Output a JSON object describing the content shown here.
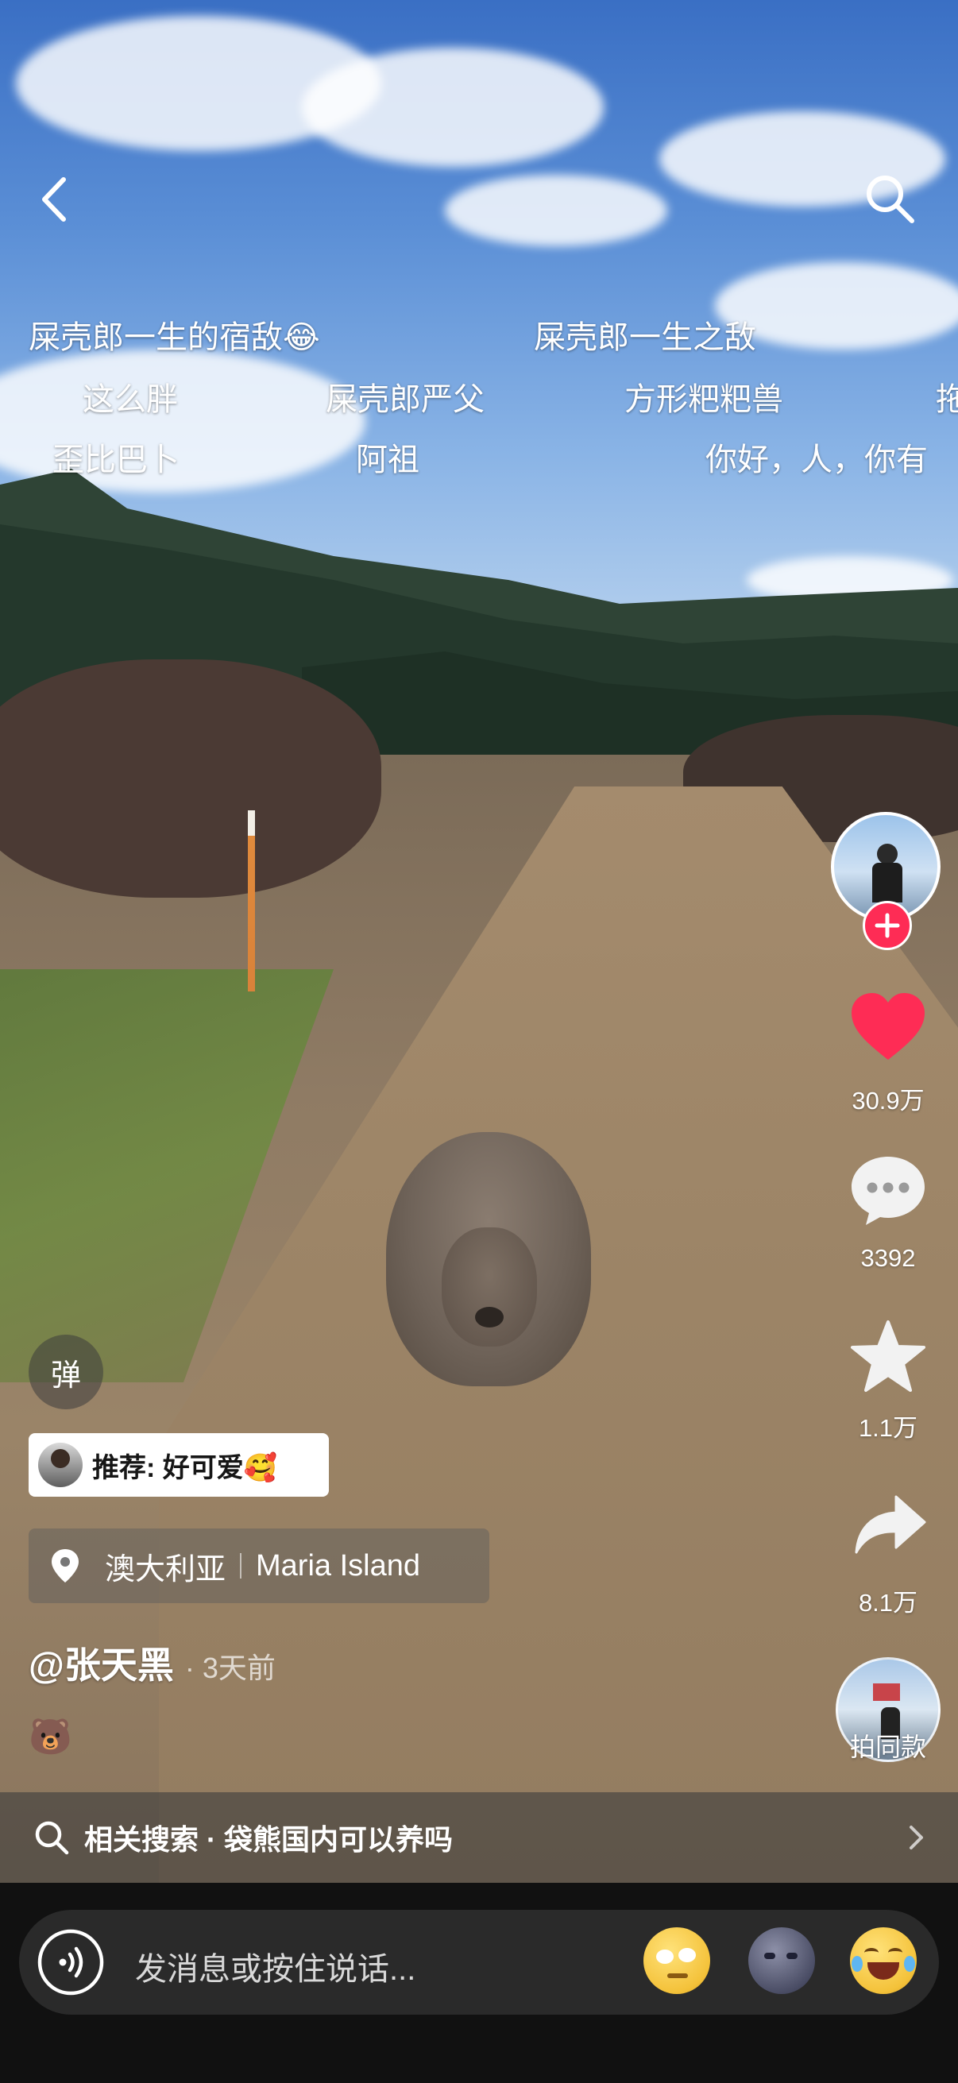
{
  "danmu": [
    "屎壳郎一生的宿敌😂",
    "屎壳郎一生之敌",
    "这么胖",
    "屎壳郎严父",
    "方形粑粑兽",
    "拖",
    "歪比巴卜",
    "阿祖",
    "你好，人，你有"
  ],
  "sidebar": {
    "like_count": "30.9万",
    "comment_count": "3392",
    "favorite_count": "1.1万",
    "share_count": "8.1万",
    "same_style_label": "拍同款"
  },
  "danmu_toggle_label": "弹",
  "recommend": {
    "label": "推荐: 好可爱🥰"
  },
  "location": {
    "country": "澳大利亚",
    "place": "Maria Island"
  },
  "author": {
    "name": "@张天黑",
    "time": "· 3天前",
    "caption": "🐻"
  },
  "related_search": {
    "prefix": "相关搜索",
    "query": "· 袋熊国内可以养吗"
  },
  "message_input": {
    "placeholder": "发消息或按住说话..."
  },
  "colors": {
    "like": "#fe2c55",
    "follow_plus": "#fe2c55",
    "bar_bg": "#111111"
  }
}
